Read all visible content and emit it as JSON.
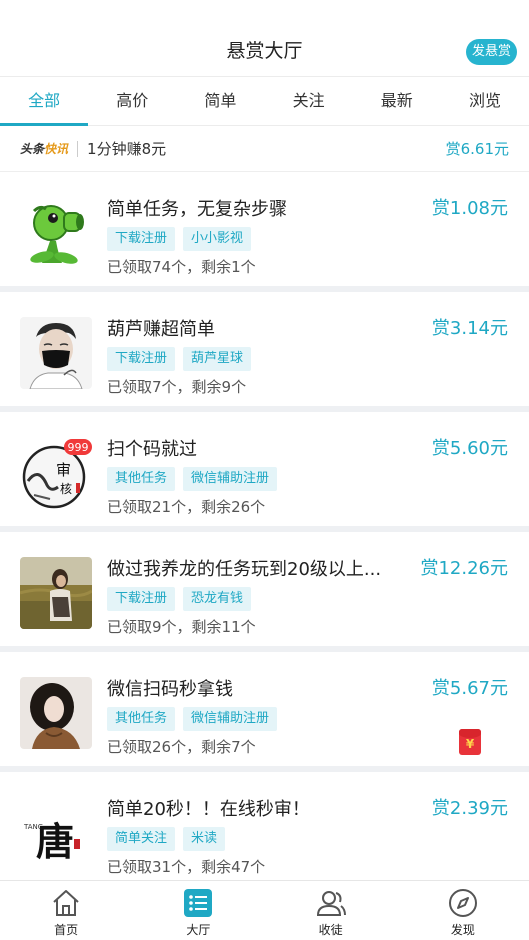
{
  "header": {
    "title": "悬赏大厅",
    "post_button": "发悬赏"
  },
  "tabs": [
    {
      "label": "全部"
    },
    {
      "label": "高价"
    },
    {
      "label": "简单"
    },
    {
      "label": "关注"
    },
    {
      "label": "最新"
    },
    {
      "label": "浏览"
    }
  ],
  "news": {
    "brand_a": "头条",
    "brand_b": "快讯",
    "text": "1分钟赚8元",
    "reward": "赏6.61元"
  },
  "tasks": [
    {
      "title": "简单任务，无复杂步骤",
      "reward": "赏1.08元",
      "tags": [
        "下载注册",
        "小小影视"
      ],
      "stats": "已领取74个，剩余1个"
    },
    {
      "title": "葫芦赚超简单",
      "reward": "赏3.14元",
      "tags": [
        "下载注册",
        "葫芦星球"
      ],
      "stats": "已领取7个，剩余9个"
    },
    {
      "title": "扫个码就过",
      "reward": "赏5.60元",
      "tags": [
        "其他任务",
        "微信辅助注册"
      ],
      "stats": "已领取21个，剩余26个",
      "avatar_text": "审核",
      "avatar_badge": "999"
    },
    {
      "title": "做过我养龙的任务玩到20级以上...",
      "reward": "赏12.26元",
      "tags": [
        "下载注册",
        "恐龙有钱"
      ],
      "stats": "已领取9个，剩余11个"
    },
    {
      "title": "微信扫码秒拿钱",
      "reward": "赏5.67元",
      "tags": [
        "其他任务",
        "微信辅助注册"
      ],
      "stats": "已领取26个，剩余7个",
      "badge": "¥"
    },
    {
      "title": "简单20秒！！在线秒审！",
      "reward": "赏2.39元",
      "tags": [
        "简单关注",
        "米读"
      ],
      "stats": "已领取31个，剩余47个",
      "avatar_text": "唐",
      "avatar_caption": "TANG"
    }
  ],
  "bottom_nav": [
    {
      "label": "首页",
      "icon": "home-icon"
    },
    {
      "label": "大厅",
      "icon": "hall-list-icon"
    },
    {
      "label": "收徒",
      "icon": "users-icon"
    },
    {
      "label": "发现",
      "icon": "compass-icon"
    }
  ],
  "colors": {
    "accent": "#1fa8c4",
    "tag_bg": "#e4f4f8",
    "divider": "#eef0f3"
  }
}
